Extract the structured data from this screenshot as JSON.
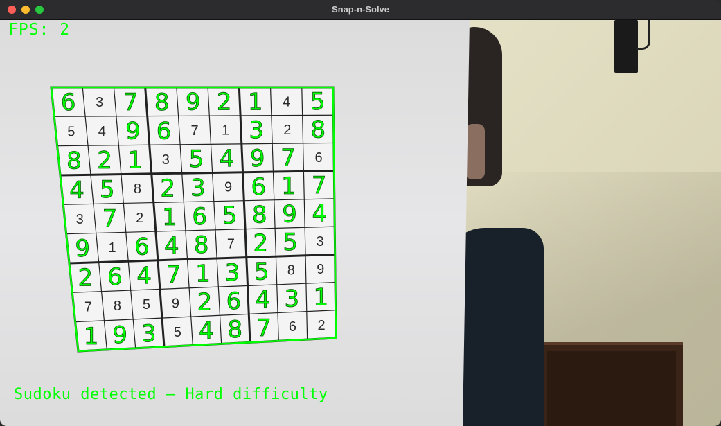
{
  "window": {
    "title": "Snap-n-Solve"
  },
  "overlay": {
    "fps_label": "FPS: 2",
    "status_text": "Sudoku detected — Hard difficulty",
    "accent_color": "#00ff00"
  },
  "sudoku": {
    "grid": [
      [
        6,
        3,
        7,
        8,
        9,
        2,
        1,
        4,
        5
      ],
      [
        5,
        4,
        9,
        6,
        7,
        1,
        3,
        2,
        8
      ],
      [
        8,
        2,
        1,
        3,
        5,
        4,
        9,
        7,
        6
      ],
      [
        4,
        5,
        8,
        2,
        3,
        9,
        6,
        1,
        7
      ],
      [
        3,
        7,
        2,
        1,
        6,
        5,
        8,
        9,
        4
      ],
      [
        9,
        1,
        6,
        4,
        8,
        7,
        2,
        5,
        3
      ],
      [
        2,
        6,
        4,
        7,
        1,
        3,
        5,
        8,
        9
      ],
      [
        7,
        8,
        5,
        9,
        2,
        6,
        4,
        3,
        1
      ],
      [
        1,
        9,
        3,
        5,
        4,
        8,
        7,
        6,
        2
      ]
    ],
    "given": [
      [
        0,
        1,
        0,
        0,
        0,
        0,
        0,
        1,
        0
      ],
      [
        1,
        1,
        0,
        0,
        1,
        1,
        0,
        1,
        0
      ],
      [
        0,
        0,
        0,
        1,
        0,
        0,
        0,
        0,
        1
      ],
      [
        0,
        0,
        1,
        0,
        0,
        1,
        0,
        0,
        0
      ],
      [
        1,
        0,
        1,
        0,
        0,
        0,
        0,
        0,
        0
      ],
      [
        0,
        1,
        0,
        0,
        0,
        1,
        0,
        0,
        1
      ],
      [
        0,
        0,
        0,
        0,
        0,
        0,
        0,
        1,
        1
      ],
      [
        1,
        1,
        1,
        1,
        0,
        0,
        0,
        0,
        0
      ],
      [
        0,
        0,
        0,
        1,
        0,
        0,
        0,
        1,
        1
      ]
    ]
  }
}
